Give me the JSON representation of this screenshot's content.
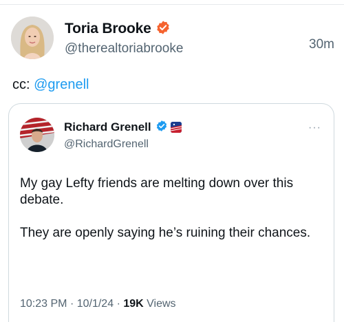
{
  "post": {
    "author_name": "Toria Brooke",
    "author_handle": "@therealtoriabrooke",
    "time": "30m",
    "text_prefix": "cc: ",
    "mention": "@grenell"
  },
  "quoted": {
    "author_name": "Richard Grenell",
    "author_handle": "@RichardGrenell",
    "more_icon": "···",
    "paragraphs": [
      "My gay Lefty friends are melting down over this debate.",
      "They are openly saying he’s ruining their chances."
    ],
    "time": "10:23 PM",
    "date": "10/1/24",
    "views_count": "19K",
    "views_label": "Views",
    "separator": "·"
  },
  "colors": {
    "verified_orange": "#f5632f",
    "verified_blue": "#1d9bf0",
    "mention": "#1d9bf0",
    "secondary_text": "#536471"
  }
}
